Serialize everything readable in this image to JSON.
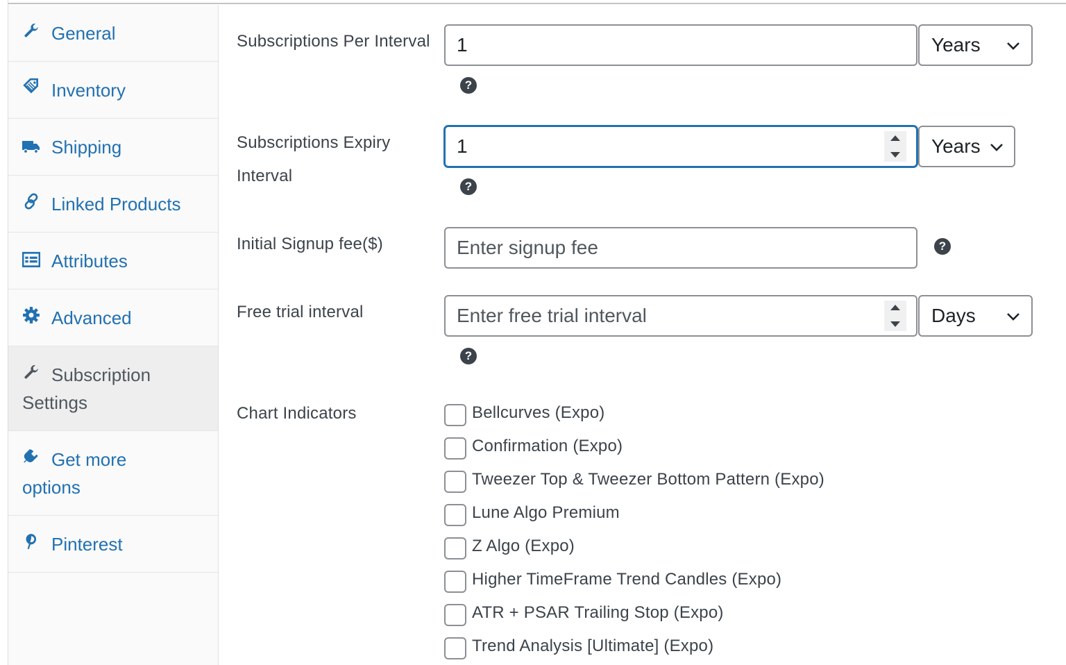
{
  "sidebar": {
    "items": [
      {
        "label": "General",
        "icon": "wrench-icon"
      },
      {
        "label": "Inventory",
        "icon": "tag-icon"
      },
      {
        "label": "Shipping",
        "icon": "truck-icon"
      },
      {
        "label": "Linked Products",
        "icon": "link-icon"
      },
      {
        "label": "Attributes",
        "icon": "list-view-icon"
      },
      {
        "label": "Advanced",
        "icon": "gear-icon"
      },
      {
        "label_line1": "Subscription",
        "label_line2": "Settings",
        "icon": "wrench-icon"
      },
      {
        "label_line1": "Get more",
        "label_line2": "options",
        "icon": "plugin-icon"
      },
      {
        "label": "Pinterest",
        "icon": "pinterest-icon"
      }
    ]
  },
  "form": {
    "per_interval": {
      "label": "Subscriptions Per Interval",
      "value": "1",
      "unit": "Years"
    },
    "expiry_interval": {
      "label_line1": "Subscriptions Expiry",
      "label_line2": "Interval",
      "value": "1",
      "unit": "Years"
    },
    "signup_fee": {
      "label": "Initial Signup fee($)",
      "placeholder": "Enter signup fee"
    },
    "free_trial": {
      "label": "Free trial interval",
      "placeholder": "Enter free trial interval",
      "unit": "Days"
    },
    "help_glyph": "?",
    "chart_indicators": {
      "label": "Chart Indicators",
      "options": [
        "Bellcurves (Expo)",
        "Confirmation (Expo)",
        "Tweezer Top & Tweezer Bottom Pattern (Expo)",
        "Lune Algo Premium",
        "Z Algo (Expo)",
        "Higher TimeFrame Trend Candles (Expo)",
        "ATR + PSAR Trailing Stop (Expo)",
        "Trend Analysis [Ultimate] (Expo)"
      ]
    }
  },
  "colors": {
    "link": "#2271b1",
    "focus": "#2271b1",
    "text": "#3c434a",
    "active_bg": "#eeeeee"
  }
}
